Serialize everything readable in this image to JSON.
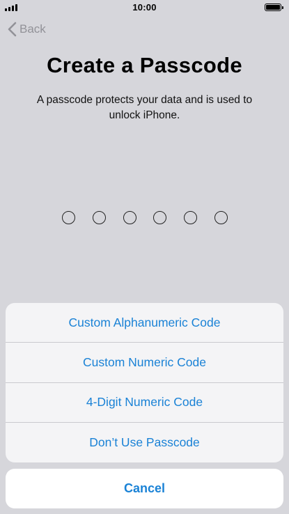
{
  "status_bar": {
    "time": "10:00",
    "signal_icon": "cellular-signal-icon",
    "battery_icon": "battery-icon",
    "battery_level": 1.0
  },
  "nav": {
    "back_label": "Back",
    "back_icon": "chevron-left-icon"
  },
  "title": "Create a Passcode",
  "description": "A passcode protects your data and is used to unlock iPhone.",
  "passcode": {
    "length": 6,
    "entered": 0
  },
  "action_sheet": {
    "options": [
      {
        "label": "Custom Alphanumeric Code"
      },
      {
        "label": "Custom Numeric Code"
      },
      {
        "label": "4-Digit Numeric Code"
      },
      {
        "label": "Don’t Use Passcode"
      }
    ],
    "cancel_label": "Cancel"
  },
  "colors": {
    "background": "#d6d6db",
    "accent": "#1a82d6",
    "back_text": "#929298",
    "sheet_background": "#f4f4f6"
  }
}
